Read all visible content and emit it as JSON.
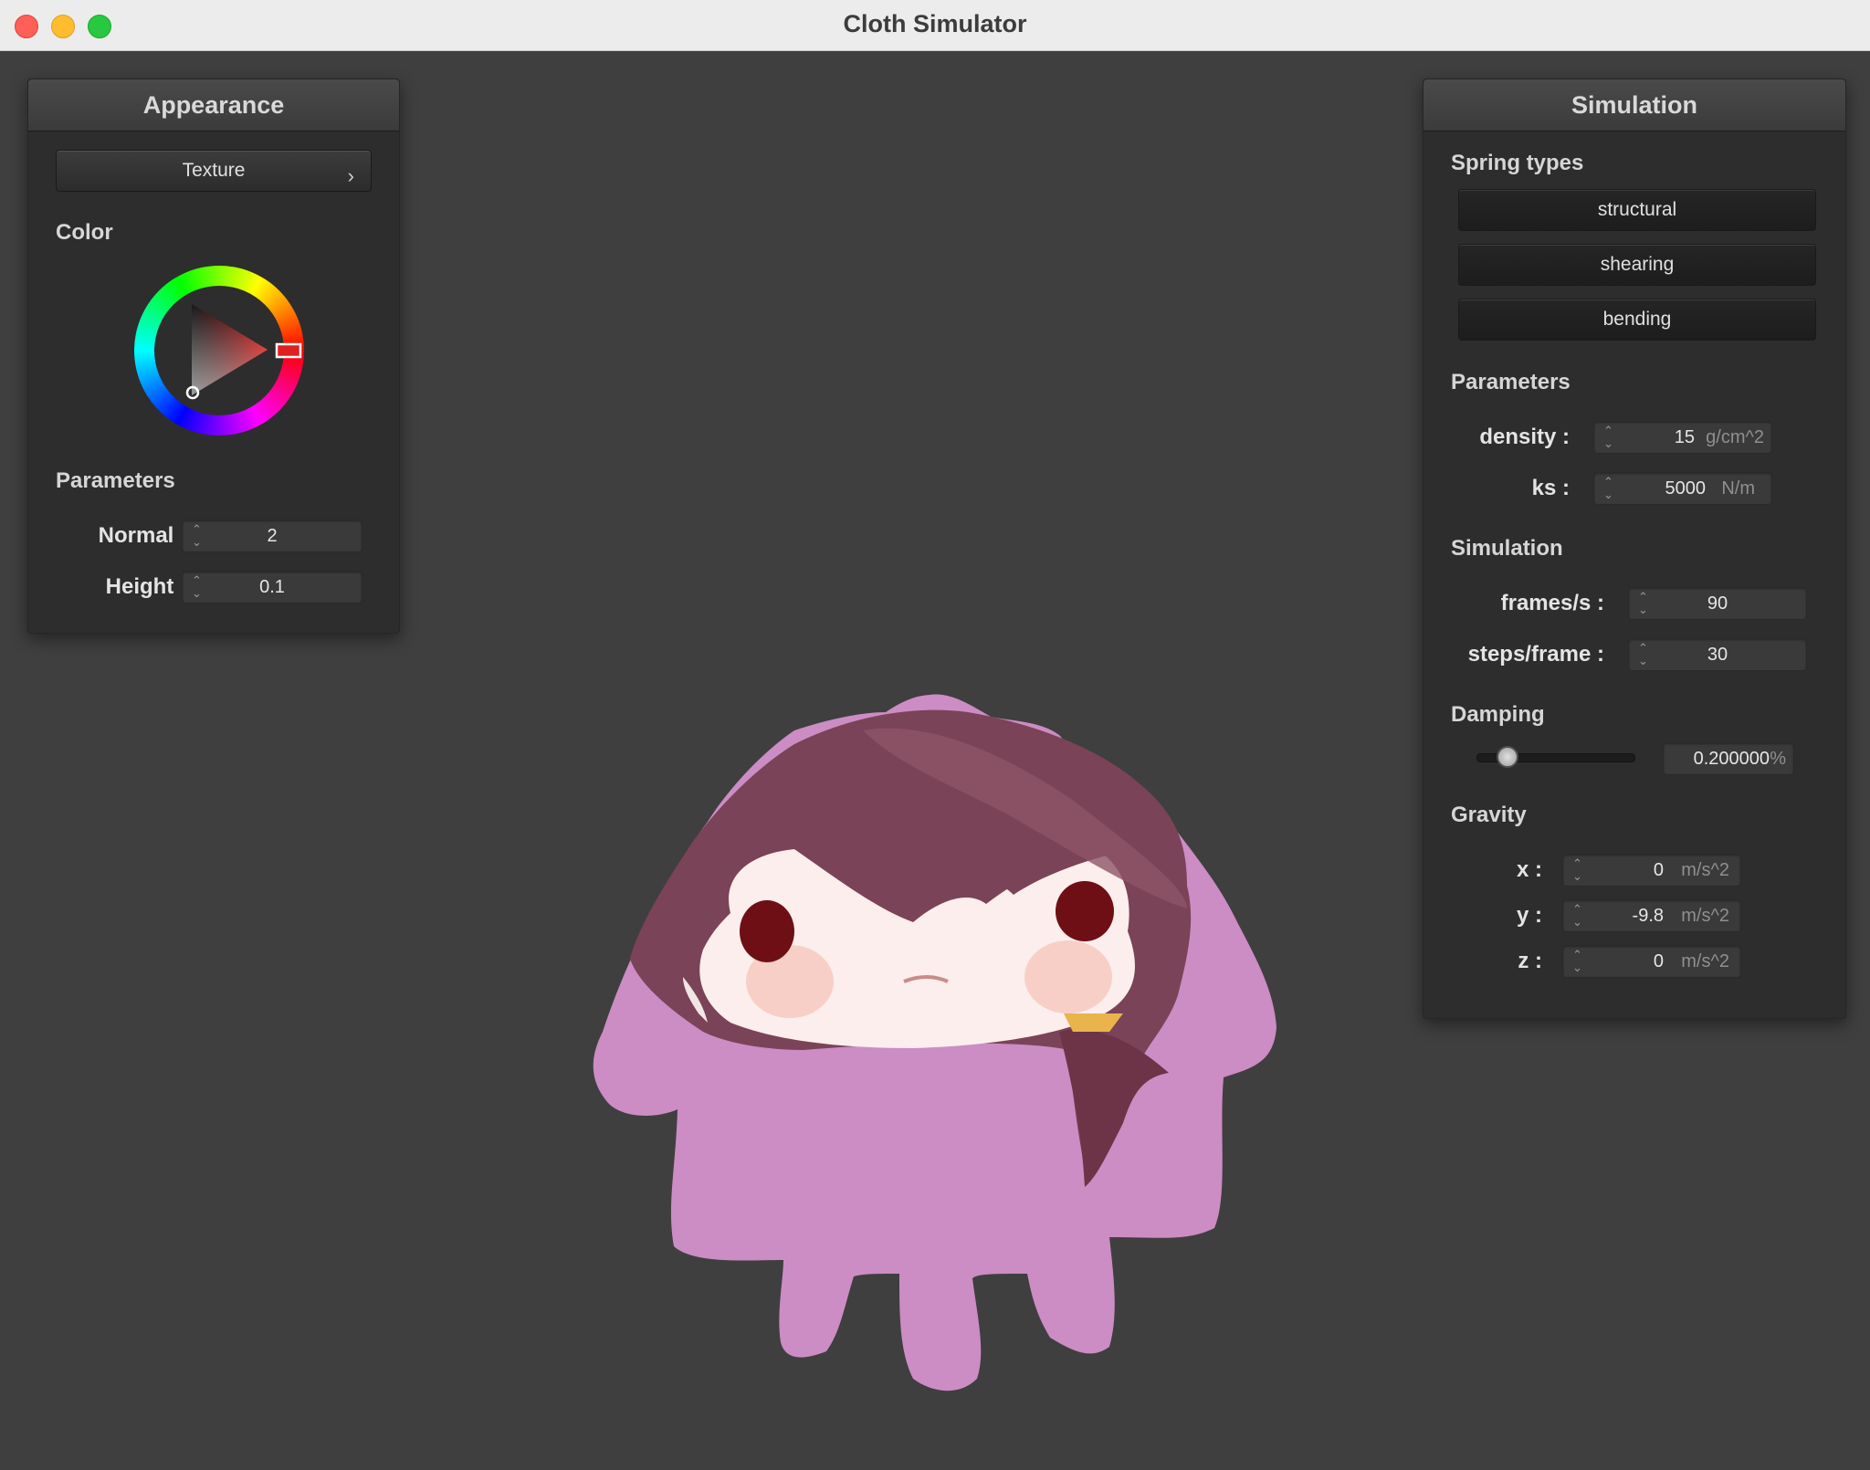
{
  "window": {
    "title": "Cloth Simulator"
  },
  "appearance": {
    "title": "Appearance",
    "texture_button": "Texture",
    "texture_chevron": "›",
    "color_label": "Color",
    "color_value": "#e02020",
    "params_label": "Parameters",
    "normal_label": "Normal :",
    "normal_value": "2",
    "height_label": "Height :",
    "height_value": "0.1"
  },
  "simulation": {
    "title": "Simulation",
    "spring_types_label": "Spring types",
    "springs": [
      "structural",
      "shearing",
      "bending"
    ],
    "params_label": "Parameters",
    "density_label": "density :",
    "density_value": "15",
    "density_unit": "g/cm^2",
    "ks_label": "ks :",
    "ks_value": "5000",
    "ks_unit": "N/m",
    "sim_label": "Simulation",
    "fps_label": "frames/s :",
    "fps_value": "90",
    "steps_label": "steps/frame :",
    "steps_value": "30",
    "damping_label": "Damping",
    "damping_value": "0.200000",
    "damping_unit": "%",
    "damping_level": 0.2,
    "gravity_label": "Gravity",
    "gx_label": "x :",
    "gx_value": "0",
    "gy_label": "y :",
    "gy_value": "-9.8",
    "gz_label": "z :",
    "gz_value": "0",
    "gravity_unit": "m/s^2"
  },
  "icons": {
    "close": "close-dot-icon",
    "minimize": "minimize-dot-icon",
    "maximize": "maximize-dot-icon",
    "stepper": "stepper-arrows-icon"
  },
  "colors": {
    "cloth": "#cc8cc4",
    "hair": "#7a4358",
    "background": "#3f3f3f"
  }
}
